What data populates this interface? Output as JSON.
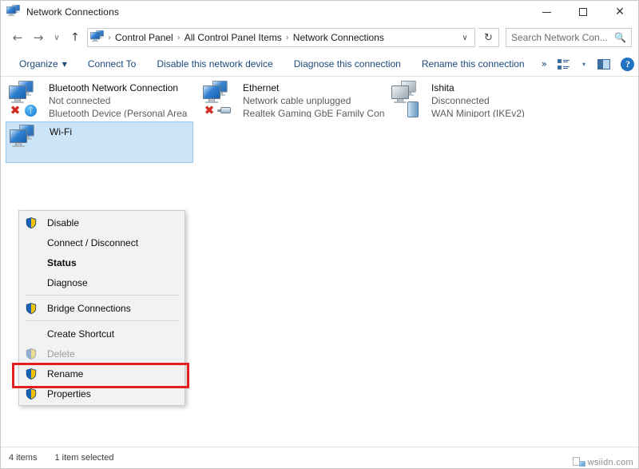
{
  "window": {
    "title": "Network Connections",
    "icon": "network-connections-icon",
    "controls": {
      "minimize": "minimize-button",
      "maximize": "maximize-button",
      "close": "close-button"
    }
  },
  "navbar": {
    "back": "back-arrow",
    "forward": "forward-arrow",
    "recent": "recent-locations-chevron",
    "up": "up-arrow",
    "breadcrumb": {
      "icon": "network-connections-icon",
      "separator": "›",
      "items": [
        "Control Panel",
        "All Control Panel Items",
        "Network Connections"
      ],
      "dropdown": "∨"
    },
    "refresh": {
      "label": "↻",
      "name": "refresh-button"
    },
    "search": {
      "placeholder": "Search Network Con...",
      "value": "",
      "icon": "search-icon"
    }
  },
  "toolbar": {
    "items": [
      {
        "label": "Organize",
        "has_caret": true
      },
      {
        "label": "Connect To",
        "has_caret": false
      },
      {
        "label": "Disable this network device",
        "has_caret": false
      },
      {
        "label": "Diagnose this connection",
        "has_caret": false
      },
      {
        "label": "Rename this connection",
        "has_caret": false
      }
    ],
    "overflow": "»",
    "view_icon": "view-options-icon",
    "view_caret": "▾",
    "preview_pane_icon": "preview-pane-icon",
    "help_icon": "help-icon",
    "help_glyph": "?"
  },
  "connections": [
    {
      "name": "Bluetooth Network Connection",
      "status": "Not connected",
      "device": "Bluetooth Device (Personal Area ...",
      "icon": "bluetooth-network-adapter-icon",
      "badge": "bluetooth",
      "disabled_mark": true,
      "selected": false
    },
    {
      "name": "Ethernet",
      "status": "Network cable unplugged",
      "device": "Realtek Gaming GbE Family Contr...",
      "icon": "ethernet-adapter-icon",
      "badge": "cable",
      "disabled_mark": true,
      "selected": false
    },
    {
      "name": "Ishita",
      "status": "Disconnected",
      "device": "WAN Miniport (IKEv2)",
      "icon": "vpn-adapter-icon",
      "badge": "server",
      "disabled_mark": false,
      "selected": false
    },
    {
      "name": "Wi-Fi",
      "status": "",
      "device": "",
      "icon": "wifi-adapter-icon",
      "badge": "none",
      "disabled_mark": false,
      "selected": true
    }
  ],
  "context_menu": {
    "target": "Wi-Fi",
    "items": [
      {
        "label": "Disable",
        "shield": true,
        "bold": false,
        "disabled": false,
        "separator_after": false
      },
      {
        "label": "Connect / Disconnect",
        "shield": false,
        "bold": false,
        "disabled": false,
        "separator_after": false
      },
      {
        "label": "Status",
        "shield": false,
        "bold": true,
        "disabled": false,
        "separator_after": false
      },
      {
        "label": "Diagnose",
        "shield": false,
        "bold": false,
        "disabled": false,
        "separator_after": true
      },
      {
        "label": "Bridge Connections",
        "shield": true,
        "bold": false,
        "disabled": false,
        "separator_after": true
      },
      {
        "label": "Create Shortcut",
        "shield": false,
        "bold": false,
        "disabled": false,
        "separator_after": false
      },
      {
        "label": "Delete",
        "shield": true,
        "bold": false,
        "disabled": true,
        "separator_after": false
      },
      {
        "label": "Rename",
        "shield": true,
        "bold": false,
        "disabled": false,
        "separator_after": false
      },
      {
        "label": "Properties",
        "shield": true,
        "bold": false,
        "disabled": false,
        "separator_after": false
      }
    ],
    "highlight": {
      "item": "Properties",
      "color": "#e41f1f"
    }
  },
  "statusbar": {
    "item_count": "4 items",
    "selection": "1 item selected",
    "watermark": "wsiidn.com"
  },
  "colors": {
    "accent": "#1d4a7a",
    "selection": "#cce4f7",
    "selection_border": "#99caee",
    "highlight_red": "#e41f1f",
    "menu_bg": "#f2f2f2",
    "help_blue": "#1f72c0"
  }
}
